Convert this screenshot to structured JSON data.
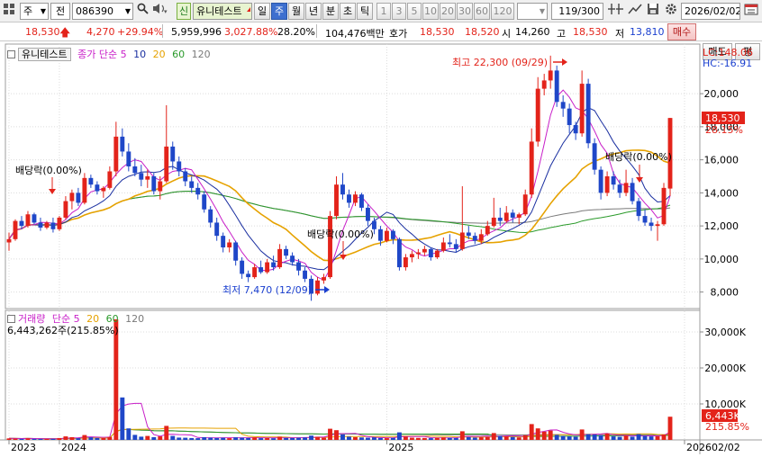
{
  "toolbar": {
    "market_prefix": "주",
    "code_prefix": "전",
    "stock_code": "086390",
    "badge": "신",
    "stock_name": "유니테스트",
    "periods": [
      "일",
      "주",
      "월",
      "년",
      "분",
      "초",
      "틱"
    ],
    "active_period": "주",
    "numbers": [
      "1",
      "3",
      "5",
      "10",
      "20",
      "30",
      "60",
      "120"
    ],
    "count": "119/300",
    "date": "2026/02/02"
  },
  "quote": {
    "price": "18,530",
    "change": "4,270",
    "change_rate": "+29.94%",
    "volume": "5,959,996",
    "volume_rate": "3,027.88%",
    "turnover": "28.20%",
    "amount": "104,476백만",
    "ask_label": "호가",
    "ask": "18,530",
    "bid": "18,520",
    "open_label": "시",
    "open": "14,260",
    "high_label": "고",
    "high": "18,530",
    "low_label": "저",
    "low": "13,810",
    "buy_label": "매수",
    "sell_label": "매도",
    "avg_label": "평"
  },
  "price_panel": {
    "stock_tag": "유니테스트",
    "legend_title": "종가 단순",
    "ma_periods": [
      "5",
      "10",
      "20",
      "60",
      "120"
    ],
    "lc": "LC:148.06",
    "hc": "HC:-16.91",
    "y_ticks": [
      "8,000",
      "10,000",
      "12,000",
      "14,000",
      "16,000",
      "18,000",
      "20,000"
    ],
    "current_price": "18,530",
    "current_rate": "28.15%",
    "high_note": "최고 22,300 (09/29)",
    "low_note": "최저 7,470 (12/09)",
    "div_label_1": "배당락(0.00%)",
    "div_label_2": "배당락(0.00%)",
    "div_label_3": "배당락(0.00%)"
  },
  "volume_panel": {
    "legend_title": "거래량",
    "legend_sub": "단순",
    "ma_periods": [
      "5",
      "20",
      "60",
      "120"
    ],
    "current": "6,443,262주(215.85%)",
    "y_ticks": [
      "10,000K",
      "20,000K",
      "30,000K"
    ],
    "current_tag": "6,443K",
    "current_rate": "215.85%"
  },
  "x_axis": {
    "labels": [
      "2023",
      "2024",
      "2025",
      "2026"
    ],
    "right_label": "02/02"
  },
  "colors": {
    "up": "#e3231a",
    "down": "#1f47c8",
    "ma5": "#c81fc8",
    "ma10": "#1a2fa0",
    "ma20": "#e6a200",
    "ma60": "#2a9a2a",
    "ma120": "#7a7a7a"
  },
  "chart_data": {
    "type": "candlestick",
    "interval": "weekly",
    "ylim": [
      7000,
      23000
    ],
    "volume_ylim": [
      0,
      36000
    ],
    "points": [
      {
        "o": 11000,
        "h": 11600,
        "l": 10500,
        "c": 11200
      },
      {
        "o": 11200,
        "h": 12400,
        "l": 11100,
        "c": 12300
      },
      {
        "o": 12300,
        "h": 12600,
        "l": 11800,
        "c": 12000
      },
      {
        "o": 12000,
        "h": 12900,
        "l": 11900,
        "c": 12700
      },
      {
        "o": 12700,
        "h": 12800,
        "l": 12100,
        "c": 12200
      },
      {
        "o": 12200,
        "h": 12500,
        "l": 11700,
        "c": 11900
      },
      {
        "o": 11900,
        "h": 12300,
        "l": 11800,
        "c": 12200
      },
      {
        "o": 12200,
        "h": 12500,
        "l": 11600,
        "c": 11800
      },
      {
        "o": 11800,
        "h": 12600,
        "l": 11700,
        "c": 12500
      },
      {
        "o": 12500,
        "h": 13800,
        "l": 12400,
        "c": 13500
      },
      {
        "o": 13500,
        "h": 14200,
        "l": 13000,
        "c": 14000
      },
      {
        "o": 14000,
        "h": 14300,
        "l": 13200,
        "c": 13400
      },
      {
        "o": 13400,
        "h": 15200,
        "l": 13300,
        "c": 14900
      },
      {
        "o": 14900,
        "h": 15100,
        "l": 14300,
        "c": 14500
      },
      {
        "o": 14500,
        "h": 14700,
        "l": 13900,
        "c": 14100
      },
      {
        "o": 14100,
        "h": 14400,
        "l": 13700,
        "c": 14300
      },
      {
        "o": 14300,
        "h": 15600,
        "l": 14200,
        "c": 15300
      },
      {
        "o": 15300,
        "h": 18300,
        "l": 15000,
        "c": 17400
      },
      {
        "o": 17400,
        "h": 17900,
        "l": 16200,
        "c": 16500
      },
      {
        "o": 16500,
        "h": 17000,
        "l": 15300,
        "c": 15600
      },
      {
        "o": 15600,
        "h": 16100,
        "l": 15000,
        "c": 15200
      },
      {
        "o": 15200,
        "h": 15700,
        "l": 14400,
        "c": 14800
      },
      {
        "o": 14800,
        "h": 15400,
        "l": 14300,
        "c": 15000
      },
      {
        "o": 15000,
        "h": 15200,
        "l": 13900,
        "c": 14100
      },
      {
        "o": 14100,
        "h": 15000,
        "l": 13600,
        "c": 14700
      },
      {
        "o": 14700,
        "h": 19300,
        "l": 14600,
        "c": 16800
      },
      {
        "o": 16800,
        "h": 17100,
        "l": 15400,
        "c": 15900
      },
      {
        "o": 15900,
        "h": 16200,
        "l": 15000,
        "c": 15300
      },
      {
        "o": 15300,
        "h": 15500,
        "l": 14400,
        "c": 14700
      },
      {
        "o": 14700,
        "h": 15000,
        "l": 14000,
        "c": 14300
      },
      {
        "o": 14300,
        "h": 14600,
        "l": 13600,
        "c": 13900
      },
      {
        "o": 13900,
        "h": 14100,
        "l": 12800,
        "c": 13000
      },
      {
        "o": 13000,
        "h": 13200,
        "l": 11900,
        "c": 12200
      },
      {
        "o": 12200,
        "h": 12500,
        "l": 11100,
        "c": 11400
      },
      {
        "o": 11400,
        "h": 11600,
        "l": 10400,
        "c": 10700
      },
      {
        "o": 10700,
        "h": 11200,
        "l": 10400,
        "c": 11000
      },
      {
        "o": 11000,
        "h": 11100,
        "l": 9600,
        "c": 9900
      },
      {
        "o": 9900,
        "h": 10100,
        "l": 8800,
        "c": 9100
      },
      {
        "o": 9100,
        "h": 9300,
        "l": 8600,
        "c": 8900
      },
      {
        "o": 8900,
        "h": 9700,
        "l": 8800,
        "c": 9500
      },
      {
        "o": 9500,
        "h": 9900,
        "l": 9100,
        "c": 9200
      },
      {
        "o": 9200,
        "h": 10000,
        "l": 9100,
        "c": 9800
      },
      {
        "o": 9800,
        "h": 10200,
        "l": 9300,
        "c": 9500
      },
      {
        "o": 9500,
        "h": 10900,
        "l": 9400,
        "c": 10600
      },
      {
        "o": 10600,
        "h": 10800,
        "l": 10000,
        "c": 10200
      },
      {
        "o": 10200,
        "h": 10400,
        "l": 9600,
        "c": 9800
      },
      {
        "o": 9800,
        "h": 10000,
        "l": 9000,
        "c": 9300
      },
      {
        "o": 9300,
        "h": 9500,
        "l": 8600,
        "c": 8800
      },
      {
        "o": 8800,
        "h": 9000,
        "l": 7470,
        "c": 7900
      },
      {
        "o": 7900,
        "h": 8900,
        "l": 7800,
        "c": 8700
      },
      {
        "o": 8700,
        "h": 9100,
        "l": 8500,
        "c": 8900
      },
      {
        "o": 8900,
        "h": 12900,
        "l": 8800,
        "c": 12600
      },
      {
        "o": 12600,
        "h": 15000,
        "l": 12400,
        "c": 14500
      },
      {
        "o": 14500,
        "h": 15200,
        "l": 13600,
        "c": 13900
      },
      {
        "o": 13900,
        "h": 14200,
        "l": 13100,
        "c": 13400
      },
      {
        "o": 13400,
        "h": 14100,
        "l": 13200,
        "c": 13900
      },
      {
        "o": 13900,
        "h": 14000,
        "l": 12900,
        "c": 13100
      },
      {
        "o": 13100,
        "h": 13300,
        "l": 12000,
        "c": 12300
      },
      {
        "o": 12300,
        "h": 12500,
        "l": 11500,
        "c": 11800
      },
      {
        "o": 11800,
        "h": 12000,
        "l": 10800,
        "c": 11100
      },
      {
        "o": 11100,
        "h": 11900,
        "l": 11000,
        "c": 11700
      },
      {
        "o": 11700,
        "h": 11800,
        "l": 10900,
        "c": 11200
      },
      {
        "o": 11200,
        "h": 11300,
        "l": 9300,
        "c": 9500
      },
      {
        "o": 9500,
        "h": 10300,
        "l": 9300,
        "c": 10100
      },
      {
        "o": 10100,
        "h": 10500,
        "l": 9800,
        "c": 10300
      },
      {
        "o": 10300,
        "h": 10600,
        "l": 10000,
        "c": 10400
      },
      {
        "o": 10400,
        "h": 10800,
        "l": 10200,
        "c": 10600
      },
      {
        "o": 10600,
        "h": 10700,
        "l": 9900,
        "c": 10100
      },
      {
        "o": 10100,
        "h": 10600,
        "l": 10000,
        "c": 10500
      },
      {
        "o": 10500,
        "h": 11300,
        "l": 10400,
        "c": 11000
      },
      {
        "o": 11000,
        "h": 11500,
        "l": 10700,
        "c": 10900
      },
      {
        "o": 10900,
        "h": 11200,
        "l": 10400,
        "c": 10600
      },
      {
        "o": 10600,
        "h": 14400,
        "l": 10500,
        "c": 11600
      },
      {
        "o": 11600,
        "h": 12000,
        "l": 11200,
        "c": 11400
      },
      {
        "o": 11400,
        "h": 11600,
        "l": 10900,
        "c": 11100
      },
      {
        "o": 11100,
        "h": 11800,
        "l": 10900,
        "c": 11500
      },
      {
        "o": 11500,
        "h": 12300,
        "l": 11400,
        "c": 12000
      },
      {
        "o": 12000,
        "h": 13700,
        "l": 11900,
        "c": 12500
      },
      {
        "o": 12500,
        "h": 13100,
        "l": 12000,
        "c": 12300
      },
      {
        "o": 12300,
        "h": 13200,
        "l": 12200,
        "c": 12800
      },
      {
        "o": 12800,
        "h": 13000,
        "l": 12200,
        "c": 12500
      },
      {
        "o": 12500,
        "h": 12800,
        "l": 12100,
        "c": 12700
      },
      {
        "o": 12700,
        "h": 14200,
        "l": 12600,
        "c": 13900
      },
      {
        "o": 13900,
        "h": 17900,
        "l": 13700,
        "c": 17100
      },
      {
        "o": 17100,
        "h": 21000,
        "l": 16800,
        "c": 20300
      },
      {
        "o": 20300,
        "h": 21200,
        "l": 19900,
        "c": 20800
      },
      {
        "o": 20800,
        "h": 22300,
        "l": 20300,
        "c": 21400
      },
      {
        "o": 21400,
        "h": 21700,
        "l": 19200,
        "c": 19500
      },
      {
        "o": 19500,
        "h": 19900,
        "l": 18600,
        "c": 19100
      },
      {
        "o": 19100,
        "h": 19400,
        "l": 17600,
        "c": 18100
      },
      {
        "o": 18100,
        "h": 18300,
        "l": 17200,
        "c": 17600
      },
      {
        "o": 17600,
        "h": 21400,
        "l": 17400,
        "c": 20600
      },
      {
        "o": 20600,
        "h": 20900,
        "l": 16700,
        "c": 17000
      },
      {
        "o": 17000,
        "h": 17300,
        "l": 15100,
        "c": 15400
      },
      {
        "o": 15400,
        "h": 15600,
        "l": 13600,
        "c": 14000
      },
      {
        "o": 14000,
        "h": 15300,
        "l": 13800,
        "c": 15000
      },
      {
        "o": 15000,
        "h": 15300,
        "l": 14200,
        "c": 14500
      },
      {
        "o": 14500,
        "h": 14800,
        "l": 13700,
        "c": 14000
      },
      {
        "o": 14000,
        "h": 15400,
        "l": 13800,
        "c": 14600
      },
      {
        "o": 14600,
        "h": 14900,
        "l": 13300,
        "c": 13500
      },
      {
        "o": 13500,
        "h": 13700,
        "l": 12300,
        "c": 12600
      },
      {
        "o": 12600,
        "h": 13000,
        "l": 12000,
        "c": 12200
      },
      {
        "o": 12200,
        "h": 12500,
        "l": 11700,
        "c": 12000
      },
      {
        "o": 12000,
        "h": 12300,
        "l": 11100,
        "c": 12100
      },
      {
        "o": 12100,
        "h": 14600,
        "l": 12000,
        "c": 14300
      },
      {
        "o": 14260,
        "h": 18530,
        "l": 13810,
        "c": 18530
      }
    ],
    "volume": [
      420,
      380,
      300,
      450,
      310,
      280,
      260,
      290,
      520,
      980,
      760,
      480,
      1350,
      720,
      540,
      500,
      820,
      33500,
      11800,
      3200,
      1400,
      900,
      1100,
      760,
      980,
      3900,
      1100,
      640,
      600,
      520,
      480,
      760,
      620,
      540,
      600,
      480,
      720,
      610,
      540,
      700,
      480,
      520,
      450,
      900,
      560,
      520,
      600,
      680,
      1200,
      840,
      600,
      3100,
      2700,
      1500,
      900,
      760,
      680,
      620,
      700,
      520,
      480,
      560,
      2100,
      900,
      620,
      560,
      540,
      480,
      600,
      700,
      560,
      520,
      2400,
      780,
      640,
      720,
      820,
      1900,
      1100,
      1000,
      780,
      700,
      1300,
      4400,
      3200,
      2300,
      2600,
      1400,
      1100,
      980,
      900,
      2900,
      1600,
      1500,
      1300,
      1800,
      980,
      860,
      1200,
      900,
      1600,
      1100,
      980,
      1000,
      1500,
      6443
    ],
    "xlabel": "",
    "ylabel": ""
  }
}
